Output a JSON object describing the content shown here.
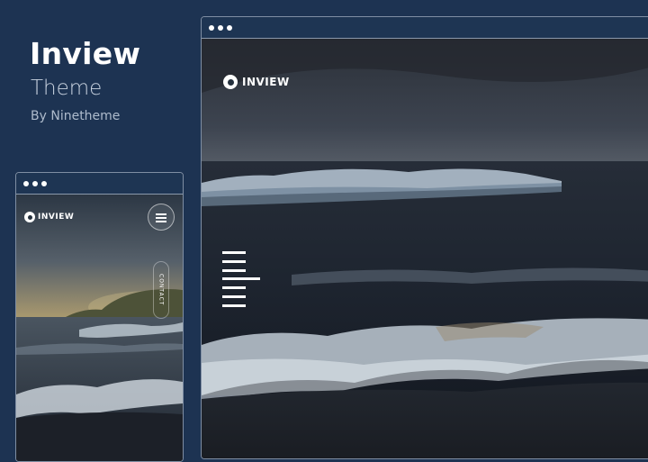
{
  "promo": {
    "title": "Inview",
    "subtitle": "Theme",
    "author": "By Ninetheme"
  },
  "desktop_preview": {
    "logo_text": "INVIEW"
  },
  "mobile_preview": {
    "logo_text": "INVIEW",
    "contact_label": "CONTACT"
  },
  "icons": {
    "window_controls": "dots-icon",
    "menu": "hamburger-icon",
    "logo": "ring-logo-icon"
  }
}
